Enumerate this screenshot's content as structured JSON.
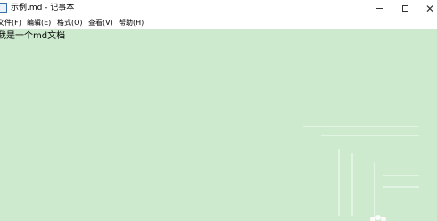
{
  "window": {
    "title": "示例.md - 记事本"
  },
  "menu": {
    "items": [
      "文件(F)",
      "编辑(E)",
      "格式(O)",
      "查看(V)",
      "帮助(H)"
    ]
  },
  "editor": {
    "content": "我是一个md文档",
    "background": "#cdeacf"
  },
  "icons": {
    "app": "notepad-icon",
    "minimize": "minimize-icon",
    "maximize": "maximize-icon",
    "close": "close-icon"
  }
}
